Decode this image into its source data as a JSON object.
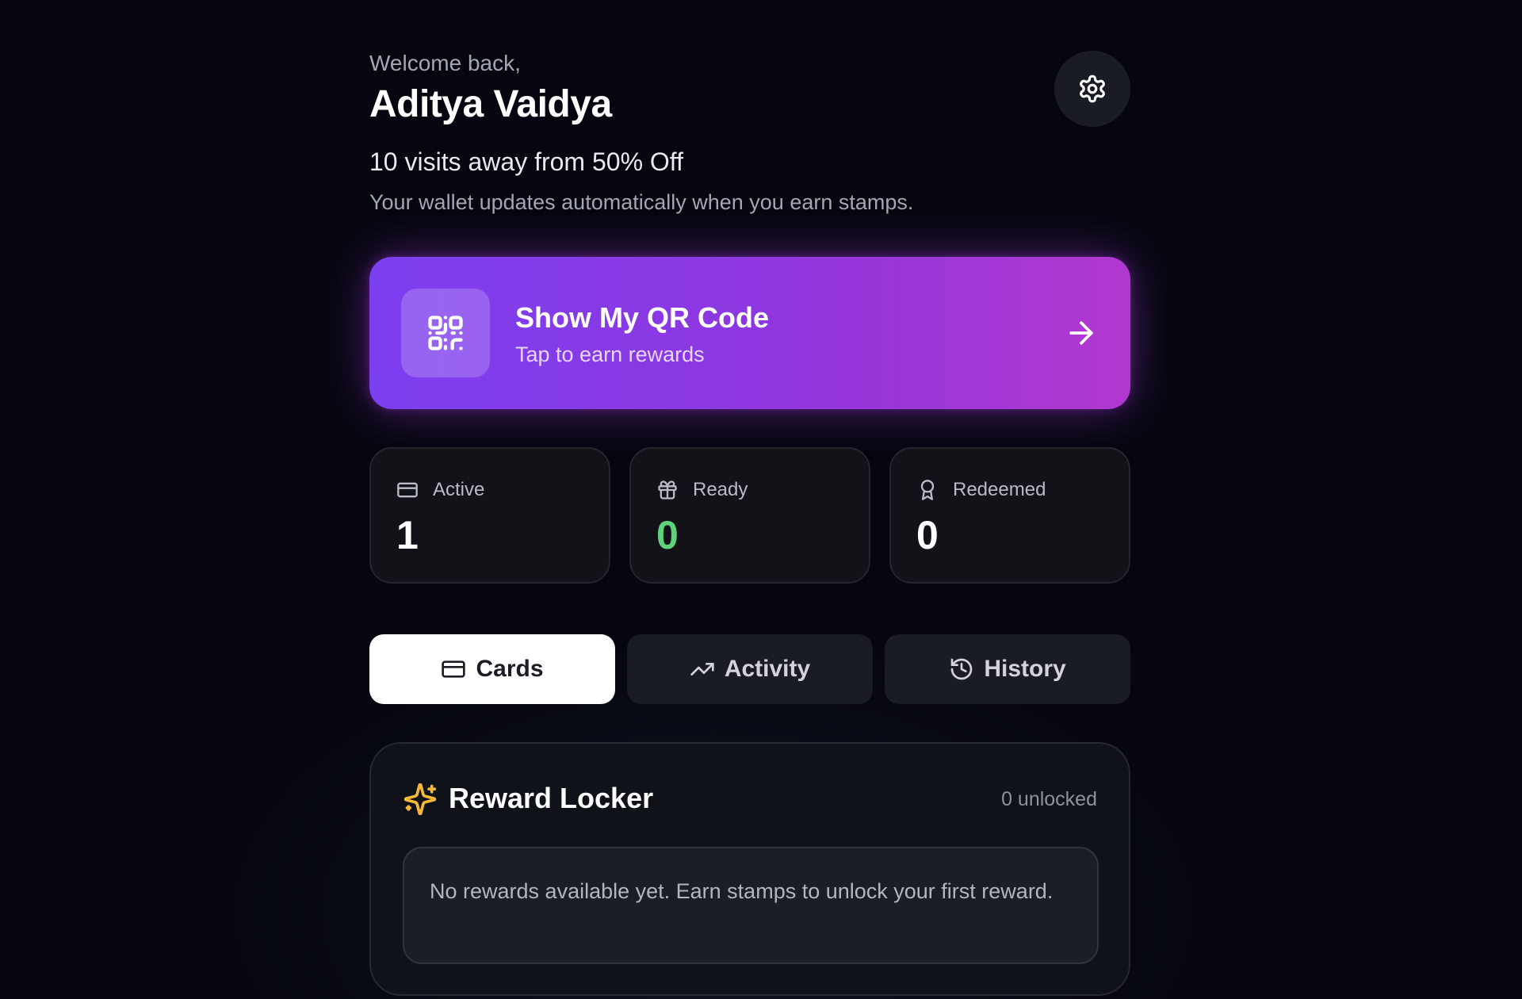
{
  "header": {
    "greeting": "Welcome back,",
    "user_name": "Aditya Vaidya",
    "progress": "10 visits away from 50% Off",
    "subtitle": "Your wallet updates automatically when you earn stamps.",
    "settings_icon": "gear-icon"
  },
  "qr_card": {
    "title": "Show My QR Code",
    "subtitle": "Tap to earn rewards",
    "icon": "qr-code-icon",
    "arrow_icon": "arrow-right-icon",
    "gradient_start": "#7b3ff0",
    "gradient_end": "#b138cf"
  },
  "stats": [
    {
      "label": "Active",
      "value": "1",
      "icon": "credit-card-icon"
    },
    {
      "label": "Ready",
      "value": "0",
      "icon": "gift-icon",
      "value_color": "#5fd37a"
    },
    {
      "label": "Redeemed",
      "value": "0",
      "icon": "award-icon"
    }
  ],
  "tabs": [
    {
      "label": "Cards",
      "icon": "credit-card-icon",
      "active": true
    },
    {
      "label": "Activity",
      "icon": "trending-up-icon",
      "active": false
    },
    {
      "label": "History",
      "icon": "history-icon",
      "active": false
    }
  ],
  "locker": {
    "title": "Reward Locker",
    "count": "0 unlocked",
    "icon": "sparkles-icon",
    "icon_color": "#f5b93a",
    "empty_message": "No rewards available yet. Earn stamps to unlock your first reward."
  }
}
